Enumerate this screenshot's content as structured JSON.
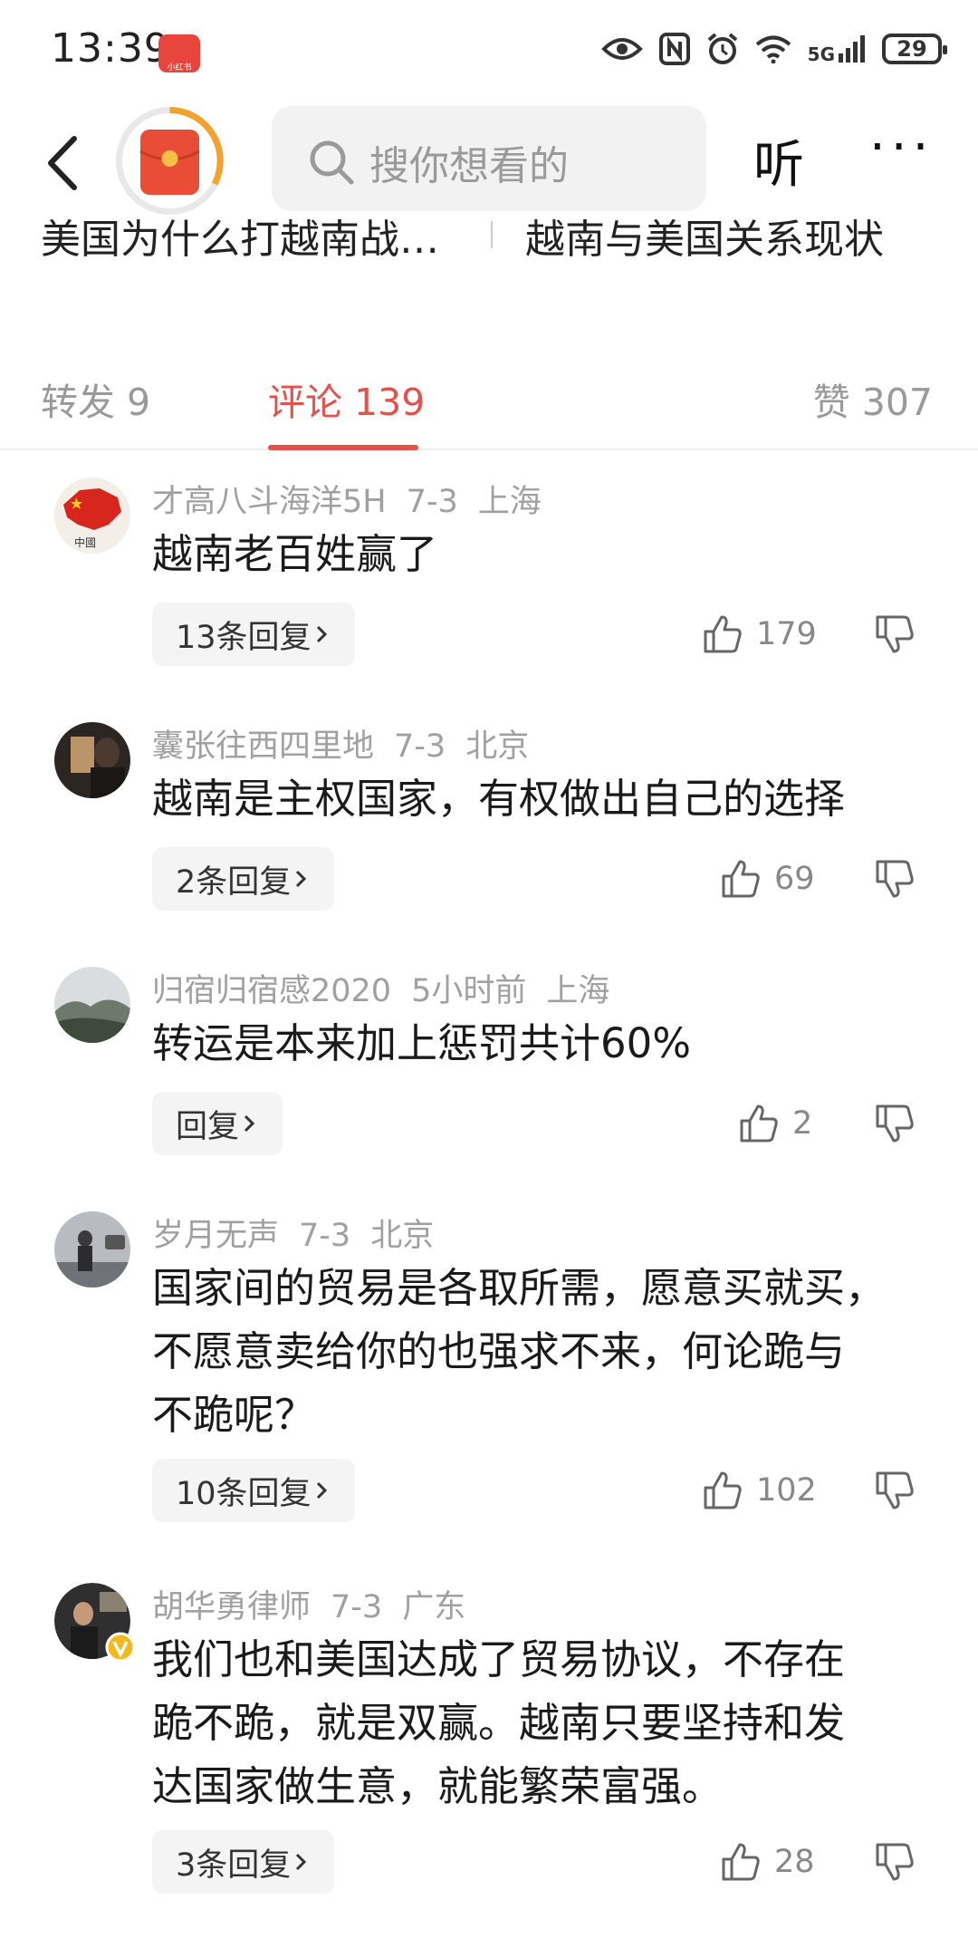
{
  "status_bar": {
    "time": "13:39",
    "app_badge": "小红书",
    "network": "5G",
    "battery": "29"
  },
  "header": {
    "search_placeholder": "搜你想看的",
    "listen_label": "听",
    "more_label": "···"
  },
  "related_searches": [
    "美国为什么打越南战…",
    "越南与美国关系现状"
  ],
  "tabs": {
    "reposts": "转发 9",
    "comments": "评论 139",
    "likes": "赞 307"
  },
  "comments": [
    {
      "user": "才高八斗海洋5H",
      "date": "7-3",
      "location": "上海",
      "lines": [
        "越南老百姓赢了"
      ],
      "replies": "13条回复",
      "likes": "179"
    },
    {
      "user": "囊张往西四里地",
      "date": "7-3",
      "location": "北京",
      "lines": [
        "越南是主权国家，有权做出自己的选择"
      ],
      "replies": "2条回复",
      "likes": "69"
    },
    {
      "user": "归宿归宿感2020",
      "date": "5小时前",
      "location": "上海",
      "lines": [
        "转运是本来加上惩罚共计60%"
      ],
      "replies": "回复",
      "likes": "2"
    },
    {
      "user": "岁月无声",
      "date": "7-3",
      "location": "北京",
      "lines": [
        "国家间的贸易是各取所需，愿意买就买，",
        "不愿意卖给你的也强求不来，何论跪与",
        "不跪呢？"
      ],
      "replies": "10条回复",
      "likes": "102"
    },
    {
      "user": "胡华勇律师",
      "date": "7-3",
      "location": "广东",
      "lines": [
        "我们也和美国达成了贸易协议，不存在",
        "跪不跪，就是双赢。越南只要坚持和发",
        "达国家做生意，就能繁荣富强。"
      ],
      "replies": "3条回复",
      "likes": "28"
    }
  ],
  "colors": {
    "accent": "#e4514a",
    "muted": "#a0a0a0"
  }
}
